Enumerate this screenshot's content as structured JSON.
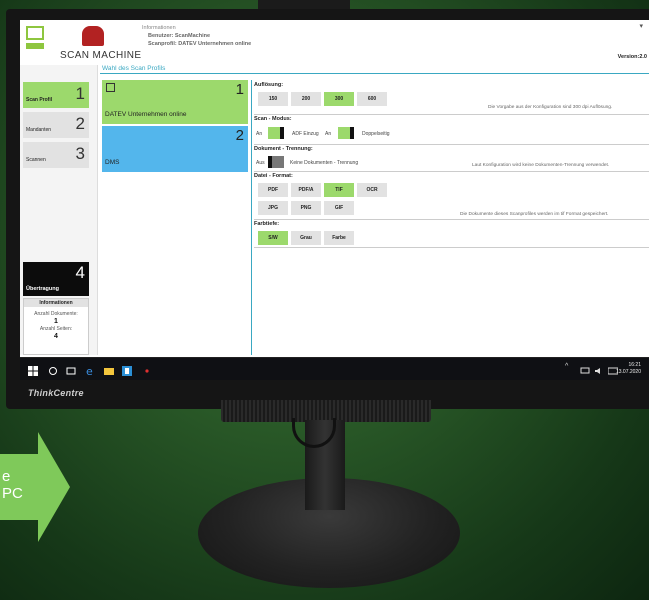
{
  "arrow": {
    "line1": "e",
    "line2": "PC"
  },
  "monitor": {
    "brand": "ThinkCentre"
  },
  "header": {
    "app_title": "SCAN MACHINE",
    "info_title": "Informationen",
    "user_line": "Benutzer: ScanMachine",
    "profile_line": "Scanprofil: DATEV Unternehmen online",
    "version": "Version:2.0"
  },
  "sidebar": {
    "items": [
      {
        "label": "Scan Profil",
        "num": "1"
      },
      {
        "label": "Mandanten",
        "num": "2"
      },
      {
        "label": "Scannen",
        "num": "3"
      }
    ],
    "transfer": {
      "label": "Übertragung",
      "num": "4"
    },
    "info": {
      "title": "Informationen",
      "docs_label": "Anzahl Dokumente:",
      "docs_value": "1",
      "pages_label": "Anzahl Seiten:",
      "pages_value": "4"
    }
  },
  "main": {
    "title": "Wahl des Scan Profils",
    "profiles": [
      {
        "label": "DATEV Unternehmen online",
        "num": "1"
      },
      {
        "label": "DMS",
        "num": "2"
      }
    ]
  },
  "settings": {
    "resolution": {
      "label": "Auflösung:",
      "options": [
        "150",
        "200",
        "300",
        "600"
      ],
      "selected": "300",
      "note": "Die Vorgabe aus der Konfiguration sind 300 dpi Auflösung."
    },
    "scan_mode": {
      "label": "Scan - Modus:",
      "adf_state": "An",
      "adf_label": "ADF Einzug",
      "duplex_state": "An",
      "duplex_label": "Doppelseitig"
    },
    "separation": {
      "label": "Dokument - Trennung:",
      "state": "Aus",
      "option_label": "Keine Dokumenten - Trennung",
      "note": "Laut Konfiguration wird keine Dokumenten-Trennung verwendet."
    },
    "format": {
      "label": "Datei - Format:",
      "options_row1": [
        "PDF",
        "PDF/A",
        "TIF",
        "OCR"
      ],
      "options_row2": [
        "JPG",
        "PNG",
        "GIF"
      ],
      "selected": "TIF",
      "note": "Die Dokumente dieses Scanprofiles werden im tif Format gespeichert."
    },
    "color": {
      "label": "Farbtiefe:",
      "options": [
        "S/W",
        "Grau",
        "Farbe"
      ],
      "selected": "S/W"
    }
  },
  "taskbar": {
    "time": "16:21",
    "date": "13.07.2020"
  }
}
